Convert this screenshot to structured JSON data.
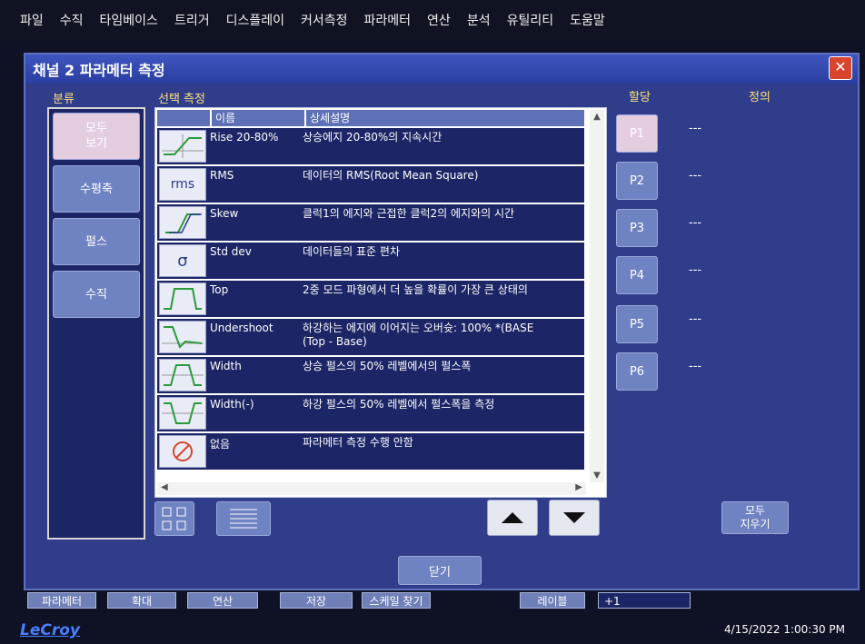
{
  "menu": [
    "파일",
    "수직",
    "타임베이스",
    "트리거",
    "디스플레이",
    "커서측정",
    "파라메터",
    "연산",
    "분석",
    "유틸리티",
    "도움말"
  ],
  "dialog": {
    "title": "채널 2 파라메터 측정",
    "close_icon": "close-icon",
    "headers": {
      "category": "분류",
      "selected": "선택 측정",
      "assign": "할당",
      "definition": "정의"
    },
    "categories": [
      {
        "label": "모두\n보기",
        "selected": true
      },
      {
        "label": "수평축",
        "selected": false
      },
      {
        "label": "펄스",
        "selected": false
      },
      {
        "label": "수직",
        "selected": false
      }
    ],
    "table": {
      "col_name": "이름",
      "col_desc": "상세설명",
      "rows": [
        {
          "icon": "rise-icon",
          "name": "Rise 20-80%",
          "desc": "상승에지 20-80%의 지속시간"
        },
        {
          "icon": "rms-icon",
          "icon_text": "rms",
          "name": "RMS",
          "desc": "데이터의 RMS(Root Mean Square)"
        },
        {
          "icon": "skew-icon",
          "name": "Skew",
          "desc": "클럭1의 에지와 근접한 클럭2의 에지와의 시간"
        },
        {
          "icon": "sigma-icon",
          "icon_text": "σ",
          "name": "Std dev",
          "desc": "데이터들의 표준 편차"
        },
        {
          "icon": "top-icon",
          "name": "Top",
          "desc": "2중 모드 파형에서 더 높을 확률이 가장 큰 상태의"
        },
        {
          "icon": "undershoot-icon",
          "name": "Undershoot",
          "desc": "하강하는 에지에 이어지는 오버슛: 100% *(BASE\n(Top - Base)"
        },
        {
          "icon": "width-icon",
          "name": "Width",
          "desc": "상승 펄스의 50% 레벨에서의 펄스폭"
        },
        {
          "icon": "width-neg-icon",
          "name": "Width(-)",
          "desc": "하강 펄스의 50% 레벨에서 펄스폭을 측정"
        },
        {
          "icon": "none-icon",
          "name": "없음",
          "desc": "파라메터 측정 수행 안함"
        }
      ]
    },
    "params": [
      {
        "label": "P1",
        "def": "---",
        "selected": true
      },
      {
        "label": "P2",
        "def": "---",
        "selected": false
      },
      {
        "label": "P3",
        "def": "---",
        "selected": false
      },
      {
        "label": "P4",
        "def": "---",
        "selected": false
      },
      {
        "label": "P5",
        "def": "---",
        "selected": false
      },
      {
        "label": "P6",
        "def": "---",
        "selected": false
      }
    ],
    "clear_all": "모두\n지우기",
    "close": "닫기"
  },
  "bottom_tabs": [
    "파라메터",
    "확대",
    "연산",
    "저장",
    "스케일 찾기",
    "레이블"
  ],
  "bottom_value": "+1",
  "logo": "LeCroy",
  "datetime": "4/15/2022 1:00:30 PM"
}
